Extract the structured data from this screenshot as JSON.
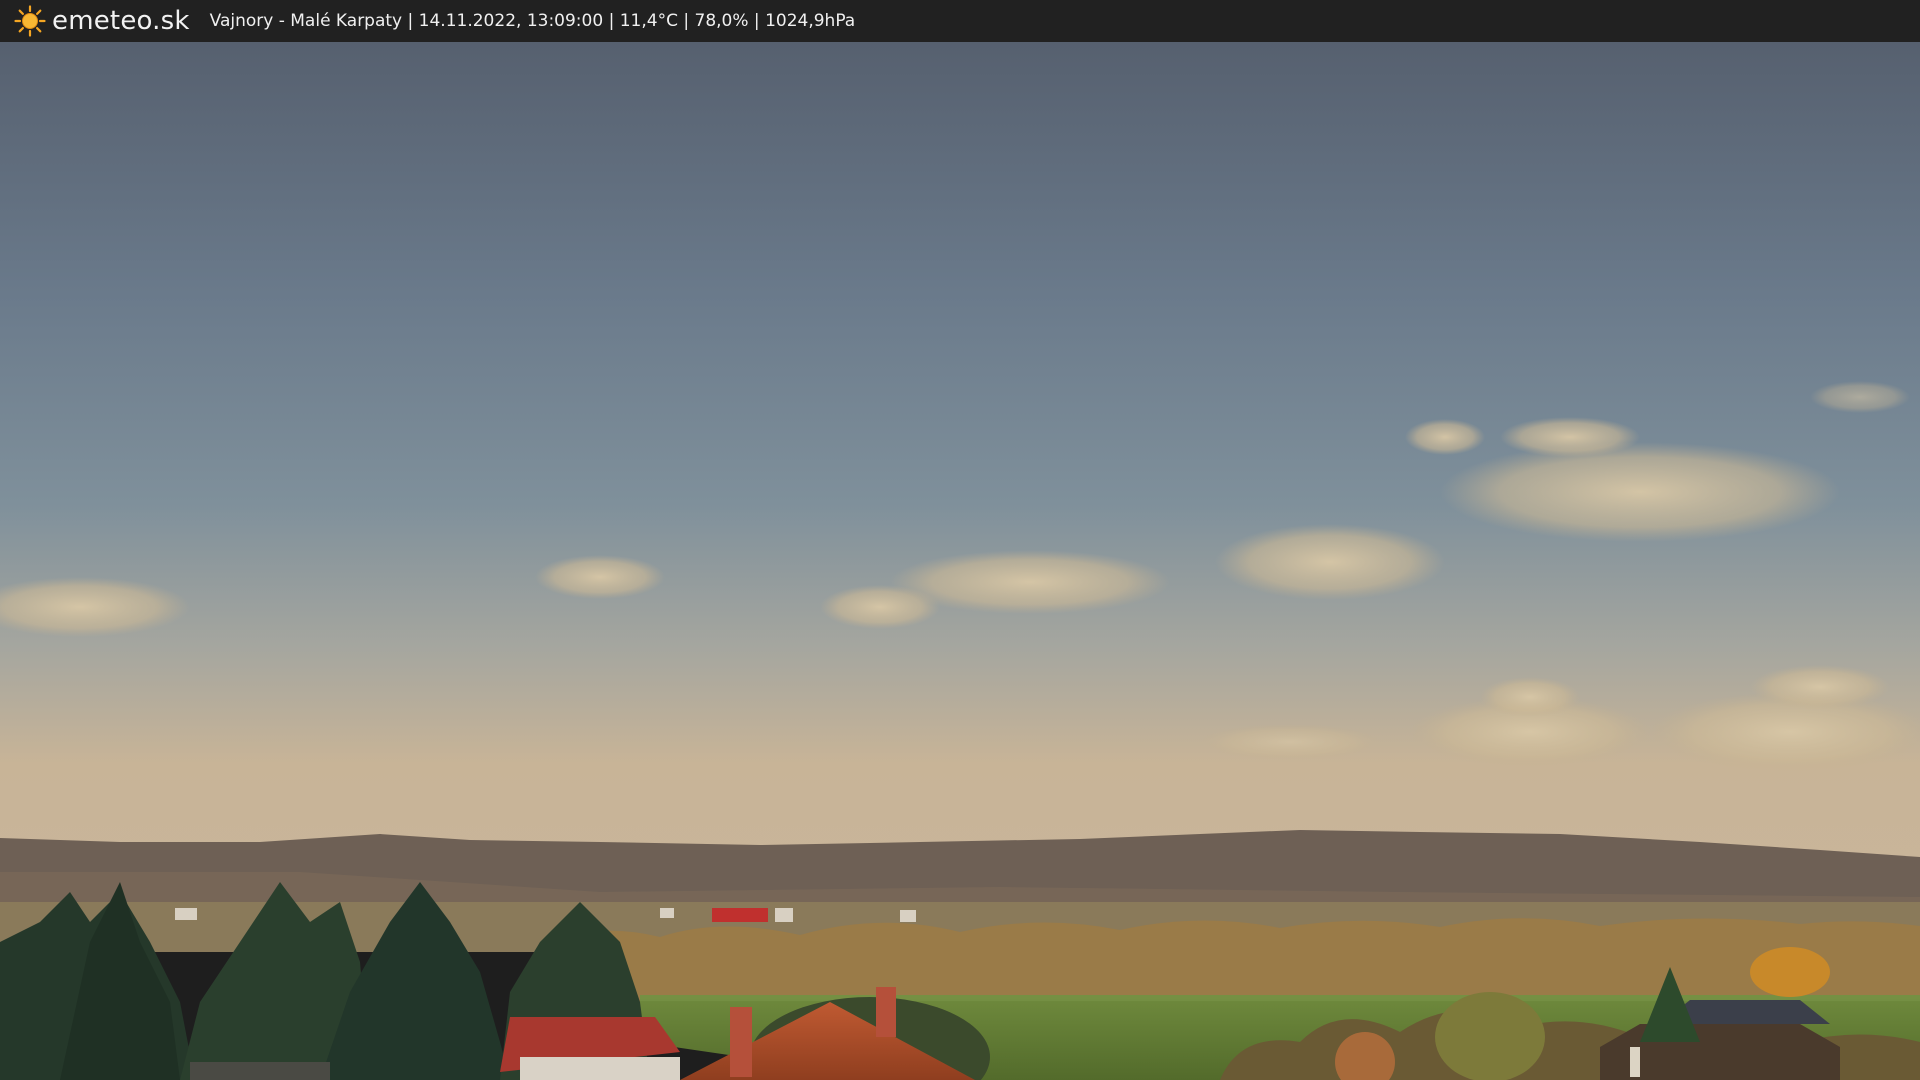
{
  "header": {
    "brand": "emeteo.sk",
    "location": "Vajnory - Malé Karpaty",
    "datetime": "14.11.2022, 13:09:00",
    "temperature": "11,4°C",
    "humidity": "78,0%",
    "pressure": "1024,9hPa",
    "separator": "|",
    "logo_icon": "sun-icon"
  },
  "colors": {
    "bar_background": "#212121",
    "sky_top": "#5a6577",
    "sky_mid": "#7b8c9b",
    "sky_horizon": "#c7b397",
    "hills": "#6d5f55",
    "field": "#5f7a34",
    "roof": "#b6542f",
    "brand_sun": "#f5a623"
  }
}
